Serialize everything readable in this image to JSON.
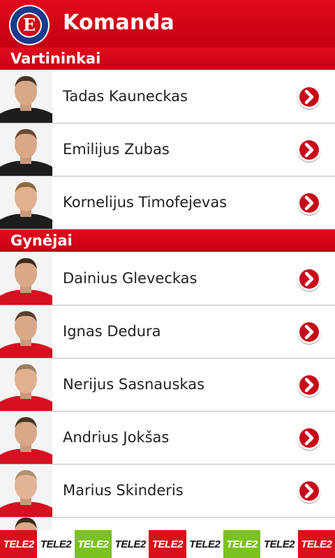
{
  "header": {
    "title": "Komanda",
    "logo_letter": "E",
    "logo_ring_text": "EKRANAS FUTBOLO KLUBAS"
  },
  "sections": [
    {
      "title": "Vartininkai"
    },
    {
      "title": "Gynėjai"
    }
  ],
  "players": [
    {
      "name": "Tadas Kauneckas",
      "kit": "black"
    },
    {
      "name": "Emilijus Zubas",
      "kit": "black"
    },
    {
      "name": "Kornelijus Timofejevas",
      "kit": "black"
    },
    {
      "name": "Dainius Gleveckas",
      "kit": "red"
    },
    {
      "name": "Ignas Dedura",
      "kit": "red"
    },
    {
      "name": "Nerijus Sasnauskas",
      "kit": "red"
    },
    {
      "name": "Andrius Jokšas",
      "kit": "red"
    },
    {
      "name": "Marius Skinderis",
      "kit": "red"
    }
  ],
  "sponsor": {
    "label": "TELE2",
    "tiles": [
      {
        "bg": "#d8101b",
        "fg": "#ffffff"
      },
      {
        "bg": "#ffffff",
        "fg": "#111111"
      },
      {
        "bg": "#7cc21e",
        "fg": "#ffffff"
      },
      {
        "bg": "#ffffff",
        "fg": "#111111"
      },
      {
        "bg": "#d8101b",
        "fg": "#ffffff"
      },
      {
        "bg": "#ffffff",
        "fg": "#111111"
      },
      {
        "bg": "#7cc21e",
        "fg": "#ffffff"
      },
      {
        "bg": "#ffffff",
        "fg": "#111111"
      },
      {
        "bg": "#d8101b",
        "fg": "#ffffff"
      }
    ]
  },
  "colors": {
    "brand_red": "#d10a1a",
    "divider": "#bdbdbd",
    "black_kit": "#1d1d1d",
    "red_kit": "#d51020"
  }
}
